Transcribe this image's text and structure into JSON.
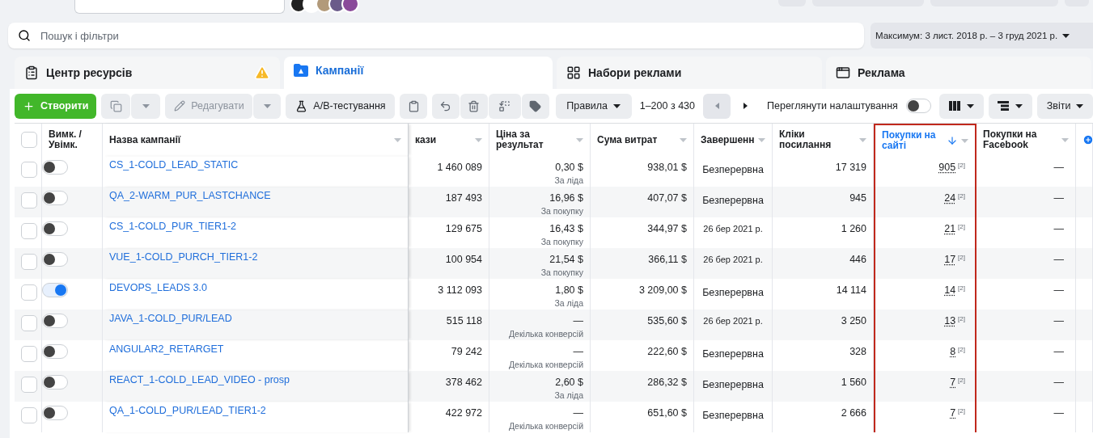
{
  "search": {
    "placeholder": "Пошук і фільтри"
  },
  "date_range": "Максимум: 3 лист. 2018 р. – 3 груд 2021 р.",
  "tabs": [
    {
      "label": "Центр ресурсів",
      "selected": false,
      "kind": "resources",
      "warning": true
    },
    {
      "label": "Кампанії",
      "selected": true,
      "kind": "campaigns",
      "warning": false
    },
    {
      "label": "Набори реклами",
      "selected": false,
      "kind": "adsets",
      "warning": false
    },
    {
      "label": "Реклама",
      "selected": false,
      "kind": "ads",
      "warning": false
    }
  ],
  "toolbar": {
    "create": "Створити",
    "edit": {
      "label": "Редагувати",
      "disabled": true
    },
    "ab_test": "A/B-тестування",
    "rules": "Правила",
    "pagination": "1–200 з 430",
    "view_settings": {
      "label": "Переглянути налаштування",
      "on": false
    },
    "reports": "Звіти"
  },
  "table": {
    "select_all": {
      "checked": false
    },
    "columns": [
      {
        "label": "Вимк. / Увімк.",
        "sorted": false,
        "highlighted": false
      },
      {
        "label": "Назва кампанії",
        "sorted": false,
        "highlighted": false
      },
      {
        "label": "кази",
        "sorted": false,
        "highlighted": false
      },
      {
        "label": "Ціна за результат",
        "sorted": false,
        "highlighted": false
      },
      {
        "label": "Сума витрат",
        "sorted": false,
        "highlighted": false
      },
      {
        "label": "Завершенн",
        "sorted": false,
        "highlighted": false
      },
      {
        "label": "Кліки посилання",
        "sorted": false,
        "highlighted": false
      },
      {
        "label": "Покупки на сайті",
        "sorted": true,
        "highlighted": true
      },
      {
        "label": "Покупки на Facebook",
        "sorted": false,
        "highlighted": false
      }
    ],
    "rows": [
      {
        "checked": false,
        "on": false,
        "name": "CS_1-COLD_LEAD_STATIC",
        "impressions": "1 460 089",
        "cost": "0,30 $",
        "cost_type": "За ліда",
        "spent": "938,01 $",
        "ends": {
          "text": "Безперервна",
          "kind": "ongoing"
        },
        "clicks": "17 319",
        "site_purchases": "905",
        "site_note": "[2]",
        "fb_purchases": "—"
      },
      {
        "checked": false,
        "on": false,
        "name": "QA_2-WARM_PUR_LASTCHANCE",
        "impressions": "187 493",
        "cost": "16,96 $",
        "cost_type": "За покупку",
        "spent": "407,07 $",
        "ends": {
          "text": "Безперервна",
          "kind": "ongoing"
        },
        "clicks": "945",
        "site_purchases": "24",
        "site_note": "[2]",
        "fb_purchases": "—"
      },
      {
        "checked": false,
        "on": false,
        "name": "CS_1-COLD_PUR_TIER1-2",
        "impressions": "129 675",
        "cost": "16,43 $",
        "cost_type": "За покупку",
        "spent": "344,97 $",
        "ends": {
          "text": "26 бер 2021 р.",
          "kind": "date"
        },
        "clicks": "1 260",
        "site_purchases": "21",
        "site_note": "[2]",
        "fb_purchases": "—"
      },
      {
        "checked": false,
        "on": false,
        "name": "VUE_1-COLD_PURCH_TIER1-2",
        "impressions": "100 954",
        "cost": "21,54 $",
        "cost_type": "За покупку",
        "spent": "366,11 $",
        "ends": {
          "text": "26 бер 2021 р.",
          "kind": "date"
        },
        "clicks": "446",
        "site_purchases": "17",
        "site_note": "[2]",
        "fb_purchases": "—"
      },
      {
        "checked": false,
        "on": true,
        "name": "DEVOPS_LEADS 3.0",
        "impressions": "3 112 093",
        "cost": "1,80 $",
        "cost_type": "За ліда",
        "spent": "3 209,00 $",
        "ends": {
          "text": "Безперервна",
          "kind": "ongoing"
        },
        "clicks": "14 114",
        "site_purchases": "14",
        "site_note": "[2]",
        "fb_purchases": "—"
      },
      {
        "checked": false,
        "on": false,
        "name": "JAVA_1-COLD_PUR/LEAD",
        "impressions": "515 118",
        "cost": "—",
        "cost_type": "Декілька конверсій",
        "spent": "535,60 $",
        "ends": {
          "text": "26 бер 2021 р.",
          "kind": "date"
        },
        "clicks": "3 250",
        "site_purchases": "13",
        "site_note": "[2]",
        "fb_purchases": "—"
      },
      {
        "checked": false,
        "on": false,
        "name": "ANGULAR2_RETARGET",
        "impressions": "79 242",
        "cost": "—",
        "cost_type": "Декілька конверсій",
        "spent": "222,60 $",
        "ends": {
          "text": "Безперервна",
          "kind": "ongoing"
        },
        "clicks": "328",
        "site_purchases": "8",
        "site_note": "[2]",
        "fb_purchases": "—"
      },
      {
        "checked": false,
        "on": false,
        "name": "REACT_1-COLD_LEAD_VIDEO - prosp",
        "impressions": "378 462",
        "cost": "2,60 $",
        "cost_type": "За ліда",
        "spent": "286,32 $",
        "ends": {
          "text": "Безперервна",
          "kind": "ongoing"
        },
        "clicks": "1 560",
        "site_purchases": "7",
        "site_note": "[2]",
        "fb_purchases": "—"
      },
      {
        "checked": false,
        "on": false,
        "name": "QA_1-COLD_PUR/LEAD_TIER1-2",
        "impressions": "422 972",
        "cost": "—",
        "cost_type": "Декілька конверсій",
        "spent": "651,60 $",
        "ends": {
          "text": "Безперервна",
          "kind": "ongoing"
        },
        "clicks": "2 666",
        "site_purchases": "7",
        "site_note": "[2]",
        "fb_purchases": "—"
      }
    ]
  }
}
